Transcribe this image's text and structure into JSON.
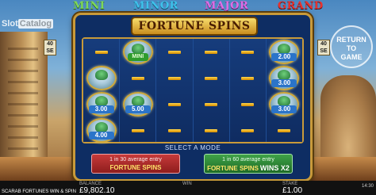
{
  "watermark": {
    "prefix": "Slot",
    "suffix": "Catalog"
  },
  "jackpots": {
    "mini": "MINI",
    "minor": "MINOR",
    "major": "MAJOR",
    "grand": "GRAND"
  },
  "side_tags": {
    "left": "40 SE",
    "right": "40 SE"
  },
  "return_button": {
    "line1": "RETURN",
    "line2": "TO",
    "line3": "GAME"
  },
  "modal": {
    "title": "FORTUNE SPINS",
    "select_label": "SELECT A MODE",
    "coins": [
      {
        "col": 1,
        "row": 1,
        "label": "MINI",
        "kind": "mini"
      },
      {
        "col": 0,
        "row": 2,
        "label": "",
        "kind": "blank"
      },
      {
        "col": 0,
        "row": 3,
        "label": "3.00",
        "kind": "value"
      },
      {
        "col": 0,
        "row": 4,
        "label": "4.00",
        "kind": "value"
      },
      {
        "col": 1,
        "row": 3,
        "label": "5.00",
        "kind": "value"
      },
      {
        "col": 5,
        "row": 1,
        "label": "2.00",
        "kind": "value"
      },
      {
        "col": 5,
        "row": 2,
        "label": "3.00",
        "kind": "value"
      },
      {
        "col": 5,
        "row": 3,
        "label": "3.00",
        "kind": "value"
      }
    ],
    "mode1": {
      "line1": "1 in 30 average entry",
      "line2": "FORTUNE SPINS"
    },
    "mode2": {
      "line1": "1 in 60 average entry",
      "line2": "FORTUNE SPINS",
      "line3": "WINS X2"
    }
  },
  "bottom": {
    "game_name": "SCARAB FORTUNES WIN & SPIN",
    "balance_label": "BALANCE",
    "balance": "£9,802.10",
    "win_label": "WIN",
    "stake_label": "STAKE",
    "stake": "£1.00",
    "clock": "14:30"
  },
  "colors": {
    "mini": "#7ed957",
    "minor": "#3dc3ec",
    "major": "#e06de6",
    "grand": "#e7322f",
    "frame": "#c89a3a"
  }
}
